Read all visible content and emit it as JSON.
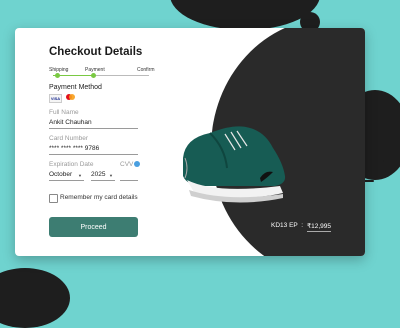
{
  "checkout": {
    "title": "Checkout Details",
    "steps": [
      "Shipping",
      "Payment",
      "Confirm"
    ],
    "payment_method_label": "Payment Method",
    "payment_icons": [
      "visa-icon",
      "mastercard-icon"
    ],
    "visa_text": "VISA",
    "full_name": {
      "label": "Full Name",
      "value": "Ankit Chauhan"
    },
    "card_number": {
      "label": "Card Number",
      "value": "**** **** **** 9786"
    },
    "expiration": {
      "label": "Expiration Date",
      "month": "October",
      "year": "2025"
    },
    "cvv": {
      "label": "CVV",
      "value": ""
    },
    "remember_label": "Remember my card details",
    "proceed_label": "Proceed"
  },
  "product": {
    "code": "KD13 EP",
    "separator": ":",
    "price": "₹12,995"
  },
  "colors": {
    "background": "#6fd3cf",
    "accent": "#3d7d72",
    "dark": "#2a2a2a",
    "step_active": "#7ac943"
  }
}
